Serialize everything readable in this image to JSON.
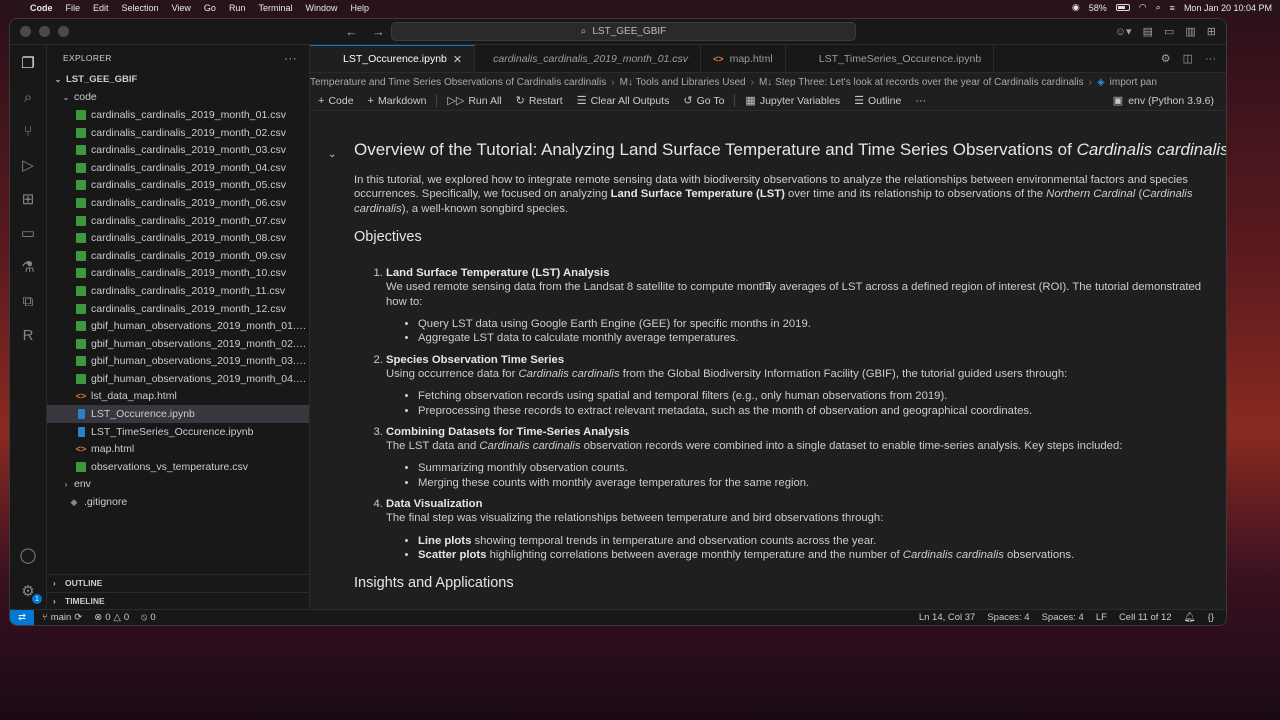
{
  "menubar": {
    "app": "Code",
    "items": [
      "File",
      "Edit",
      "Selection",
      "View",
      "Go",
      "Run",
      "Terminal",
      "Window",
      "Help"
    ],
    "battery": "58%",
    "battery_fill": 0.58,
    "datetime": "Mon Jan 20  10:04 PM"
  },
  "titlebar": {
    "search": "LST_GEE_GBIF"
  },
  "explorer": {
    "title": "EXPLORER",
    "root": "LST_GEE_GBIF",
    "folder": "code",
    "files": [
      {
        "name": "cardinalis_cardinalis_2019_month_01.csv",
        "type": "csv"
      },
      {
        "name": "cardinalis_cardinalis_2019_month_02.csv",
        "type": "csv"
      },
      {
        "name": "cardinalis_cardinalis_2019_month_03.csv",
        "type": "csv"
      },
      {
        "name": "cardinalis_cardinalis_2019_month_04.csv",
        "type": "csv"
      },
      {
        "name": "cardinalis_cardinalis_2019_month_05.csv",
        "type": "csv"
      },
      {
        "name": "cardinalis_cardinalis_2019_month_06.csv",
        "type": "csv"
      },
      {
        "name": "cardinalis_cardinalis_2019_month_07.csv",
        "type": "csv"
      },
      {
        "name": "cardinalis_cardinalis_2019_month_08.csv",
        "type": "csv"
      },
      {
        "name": "cardinalis_cardinalis_2019_month_09.csv",
        "type": "csv"
      },
      {
        "name": "cardinalis_cardinalis_2019_month_10.csv",
        "type": "csv"
      },
      {
        "name": "cardinalis_cardinalis_2019_month_11.csv",
        "type": "csv"
      },
      {
        "name": "cardinalis_cardinalis_2019_month_12.csv",
        "type": "csv"
      },
      {
        "name": "gbif_human_observations_2019_month_01.csv",
        "type": "csv"
      },
      {
        "name": "gbif_human_observations_2019_month_02.c...",
        "type": "csv"
      },
      {
        "name": "gbif_human_observations_2019_month_03.c...",
        "type": "csv"
      },
      {
        "name": "gbif_human_observations_2019_month_04.c...",
        "type": "csv"
      },
      {
        "name": "lst_data_map.html",
        "type": "html"
      },
      {
        "name": "LST_Occurence.ipynb",
        "type": "ipynb"
      },
      {
        "name": "LST_TimeSeries_Occurence.ipynb",
        "type": "ipynb"
      },
      {
        "name": "map.html",
        "type": "html"
      },
      {
        "name": "observations_vs_temperature.csv",
        "type": "csv"
      }
    ],
    "env": "env",
    "gitignore": ".gitignore",
    "outline": "OUTLINE",
    "timeline": "TIMELINE"
  },
  "tabs": [
    {
      "label": "LST_Occurence.ipynb"
    },
    {
      "label": "cardinalis_cardinalis_2019_month_01.csv"
    },
    {
      "label": "map.html"
    },
    {
      "label": "LST_TimeSeries_Occurence.ipynb"
    }
  ],
  "breadcrumbs": [
    "Temperature and Time Series Observations of Cardinalis cardinalis",
    "M↓ Tools and Libraries Used",
    "M↓ Step Three: Let's look at records over the year of Cardinalis cardinalis",
    "import pan"
  ],
  "toolbar": {
    "code": "Code",
    "markdown": "Markdown",
    "run_all": "Run All",
    "restart": "Restart",
    "clear": "Clear All Outputs",
    "goto": "Go To",
    "variables": "Jupyter Variables",
    "outline": "Outline",
    "kernel": "env (Python 3.9.6)"
  },
  "notebook": {
    "title_prefix": "Overview of the Tutorial: Analyzing Land Surface Temperature and Time Series Observations of ",
    "title_italic": "Cardinalis cardinalis",
    "intro": {
      "a": "In this tutorial, we explored how to integrate remote sensing data with biodiversity observations to analyze the relationships between environmental factors and species occurrences. Specifically, we focused on analyzing ",
      "b": "Land Surface Temperature (LST)",
      "c": " over time and its relationship to observations of the ",
      "d": "Northern Cardinal",
      "e": " (",
      "f": "Cardinalis cardinalis",
      "g": "), a well-known songbird species."
    },
    "objectives_heading": "Objectives",
    "obj1": {
      "title": "Land Surface Temperature (LST) Analysis",
      "text": "We used remote sensing data from the Landsat 8 satellite to compute monthly averages of LST across a defined region of interest (ROI). The tutorial demonstrated how to:",
      "bullets": [
        "Query LST data using Google Earth Engine (GEE) for specific months in 2019.",
        "Aggregate LST data to calculate monthly average temperatures."
      ]
    },
    "obj2": {
      "title": "Species Observation Time Series",
      "text_a": "Using occurrence data for ",
      "text_b": "Cardinalis cardinalis",
      "text_c": " from the Global Biodiversity Information Facility (GBIF), the tutorial guided users through:",
      "bullets": [
        "Fetching observation records using spatial and temporal filters (e.g., only human observations from 2019).",
        "Preprocessing these records to extract relevant metadata, such as the month of observation and geographical coordinates."
      ]
    },
    "obj3": {
      "title": "Combining Datasets for Time-Series Analysis",
      "text_a": "The LST data and ",
      "text_b": "Cardinalis cardinalis",
      "text_c": " observation records were combined into a single dataset to enable time-series analysis. Key steps included:",
      "bullets": [
        "Summarizing monthly observation counts.",
        "Merging these counts with monthly average temperatures for the same region."
      ]
    },
    "obj4": {
      "title": "Data Visualization",
      "text": "The final step was visualizing the relationships between temperature and bird observations through:",
      "b1_bold": "Line plots",
      "b1_rest": " showing temporal trends in temperature and observation counts across the year.",
      "b2_bold": "Scatter plots",
      "b2_rest": " highlighting correlations between average monthly temperature and the number of ",
      "b2_italic": "Cardinalis cardinalis",
      "b2_end": " observations."
    },
    "insights_heading": "Insights and Applications"
  },
  "statusbar": {
    "branch": "main",
    "errors": "0",
    "warnings": "0",
    "ports": "0",
    "position": "Ln 14, Col 37",
    "spaces1": "Spaces: 4",
    "spaces2": "Spaces: 4",
    "eol": "LF",
    "cell": "Cell 11 of 12",
    "braces": "{}"
  }
}
